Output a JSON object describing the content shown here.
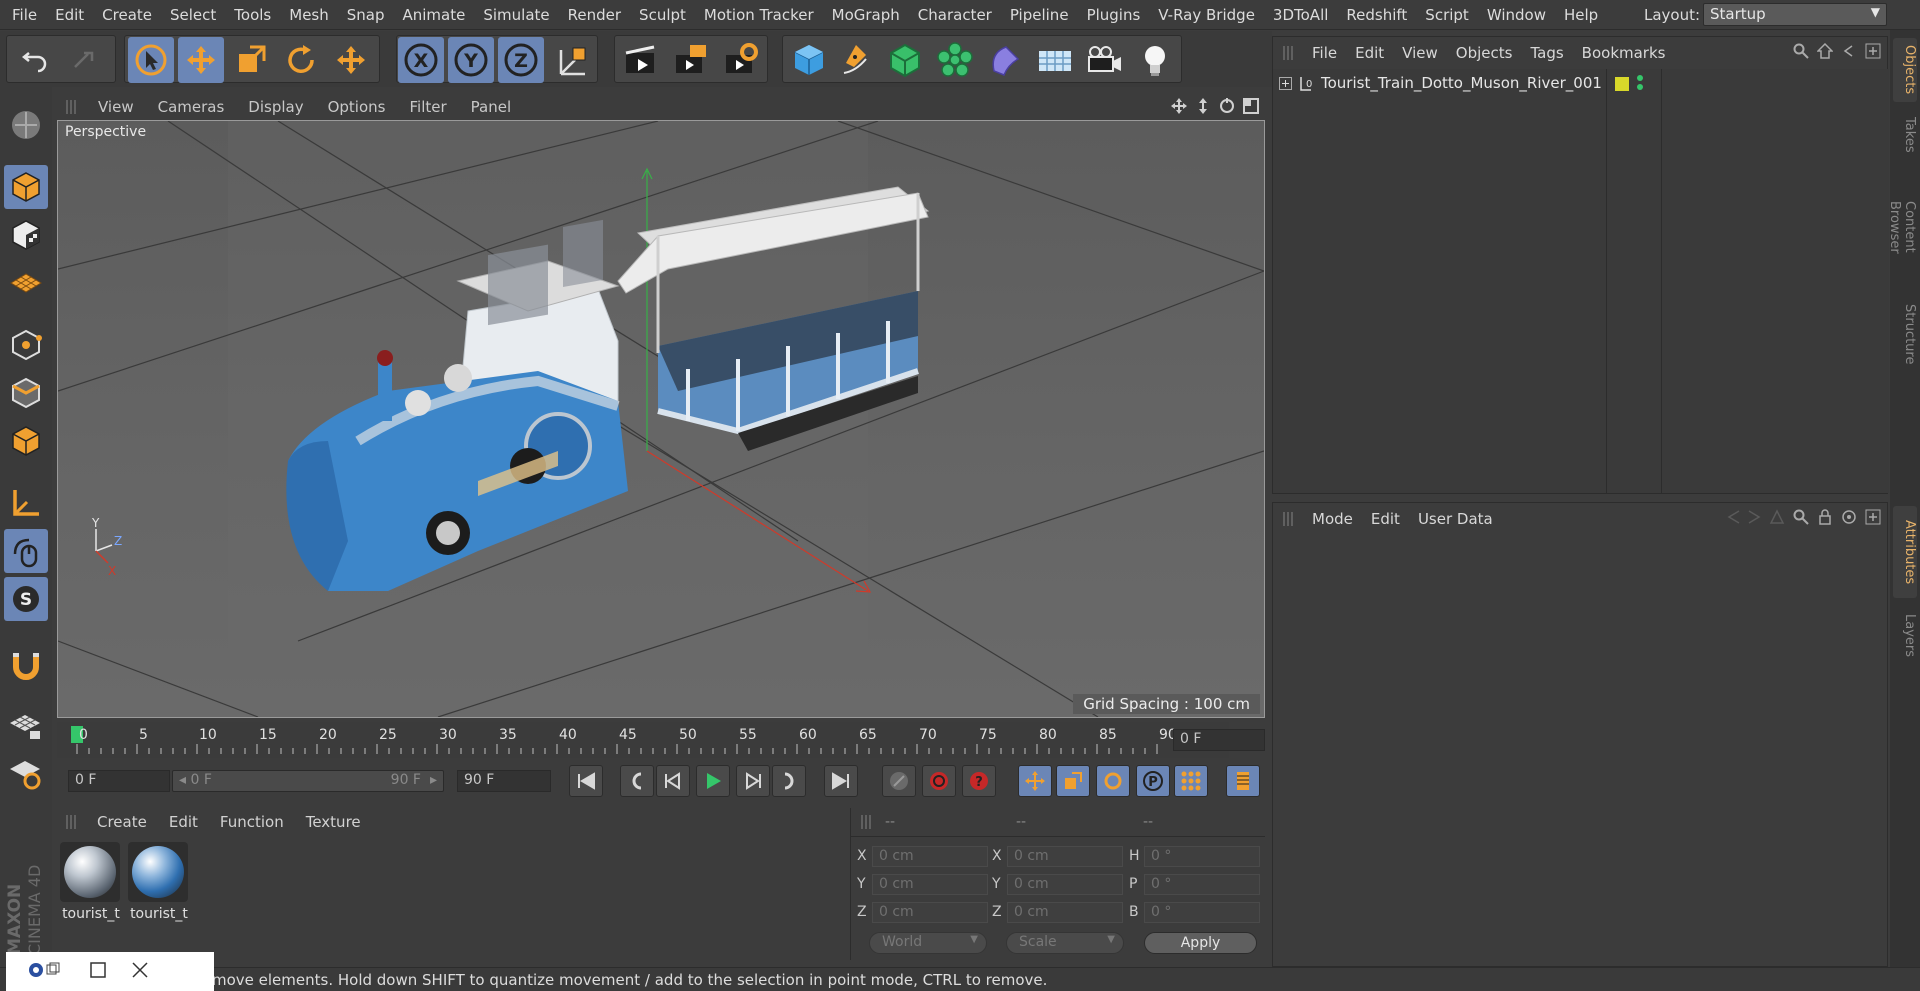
{
  "menubar": {
    "items": [
      "File",
      "Edit",
      "Create",
      "Select",
      "Tools",
      "Mesh",
      "Snap",
      "Animate",
      "Simulate",
      "Render",
      "Sculpt",
      "Motion Tracker",
      "MoGraph",
      "Character",
      "Pipeline",
      "Plugins",
      "V-Ray Bridge",
      "3DToAll",
      "Redshift",
      "Script",
      "Window",
      "Help"
    ],
    "layout_label": "Layout:",
    "layout_value": "Startup"
  },
  "toolbar": {
    "icons": [
      "undo-icon",
      "redo-icon",
      "select-arrow-icon",
      "move-icon",
      "scale-icon",
      "rotate-icon",
      "move-plus-icon",
      "x-axis-icon",
      "y-axis-icon",
      "z-axis-icon",
      "coordinate-system-icon",
      "render-view-icon",
      "render-picture-viewer-icon",
      "render-settings-icon",
      "cube-icon",
      "pen-icon",
      "subdivision-icon",
      "mograph-cloner-icon",
      "deformer-icon",
      "floor-icon",
      "camera-icon",
      "light-icon"
    ],
    "axis_x": "X",
    "axis_y": "Y",
    "axis_z": "Z"
  },
  "viewport": {
    "menu": [
      "View",
      "Cameras",
      "Display",
      "Options",
      "Filter",
      "Panel"
    ],
    "label": "Perspective",
    "grid_spacing": "Grid Spacing : 100 cm",
    "axis_letters": {
      "x": "X",
      "y": "Y",
      "z": "Z"
    }
  },
  "timeline": {
    "ticks": [
      "0",
      "5",
      "10",
      "15",
      "20",
      "25",
      "30",
      "35",
      "40",
      "45",
      "50",
      "55",
      "60",
      "65",
      "70",
      "75",
      "80",
      "85",
      "90"
    ],
    "current_frame": "0 F",
    "start_frame": "0 F",
    "range_start": "0 F",
    "range_end": "90 F",
    "end_frame": "90 F"
  },
  "materials": {
    "menu": [
      "Create",
      "Edit",
      "Function",
      "Texture"
    ],
    "items": [
      {
        "name": "tourist_t"
      },
      {
        "name": "tourist_t"
      }
    ]
  },
  "coordinates": {
    "headers": [
      "--",
      "--",
      "--"
    ],
    "rows": [
      {
        "l1": "X",
        "v1": "0 cm",
        "l2": "X",
        "v2": "0 cm",
        "l3": "H",
        "v3": "0 °"
      },
      {
        "l1": "Y",
        "v1": "0 cm",
        "l2": "Y",
        "v2": "0 cm",
        "l3": "P",
        "v3": "0 °"
      },
      {
        "l1": "Z",
        "v1": "0 cm",
        "l2": "Z",
        "v2": "0 cm",
        "l3": "B",
        "v3": "0 °"
      }
    ],
    "space": "World",
    "mode": "Scale",
    "apply": "Apply"
  },
  "objects": {
    "menu": [
      "File",
      "Edit",
      "View",
      "Objects",
      "Tags",
      "Bookmarks"
    ],
    "items": [
      {
        "name": "Tourist_Train_Dotto_Muson_River_001",
        "layer_color": "#d8d82a"
      }
    ]
  },
  "attributes": {
    "menu": [
      "Mode",
      "Edit",
      "User Data"
    ]
  },
  "sidetabs": [
    "Objects",
    "Takes",
    "Content Browser",
    "Structure",
    "Attributes",
    "Layers"
  ],
  "status": {
    "text": "move elements. Hold down SHIFT to quantize movement / add to the selection in point mode, CTRL to remove."
  },
  "brand": {
    "line1": "MAXON",
    "line2": "CINEMA 4D"
  },
  "colors": {
    "accent": "#6b86b6",
    "orange": "#f0a030",
    "panel": "#3c3c3c"
  }
}
